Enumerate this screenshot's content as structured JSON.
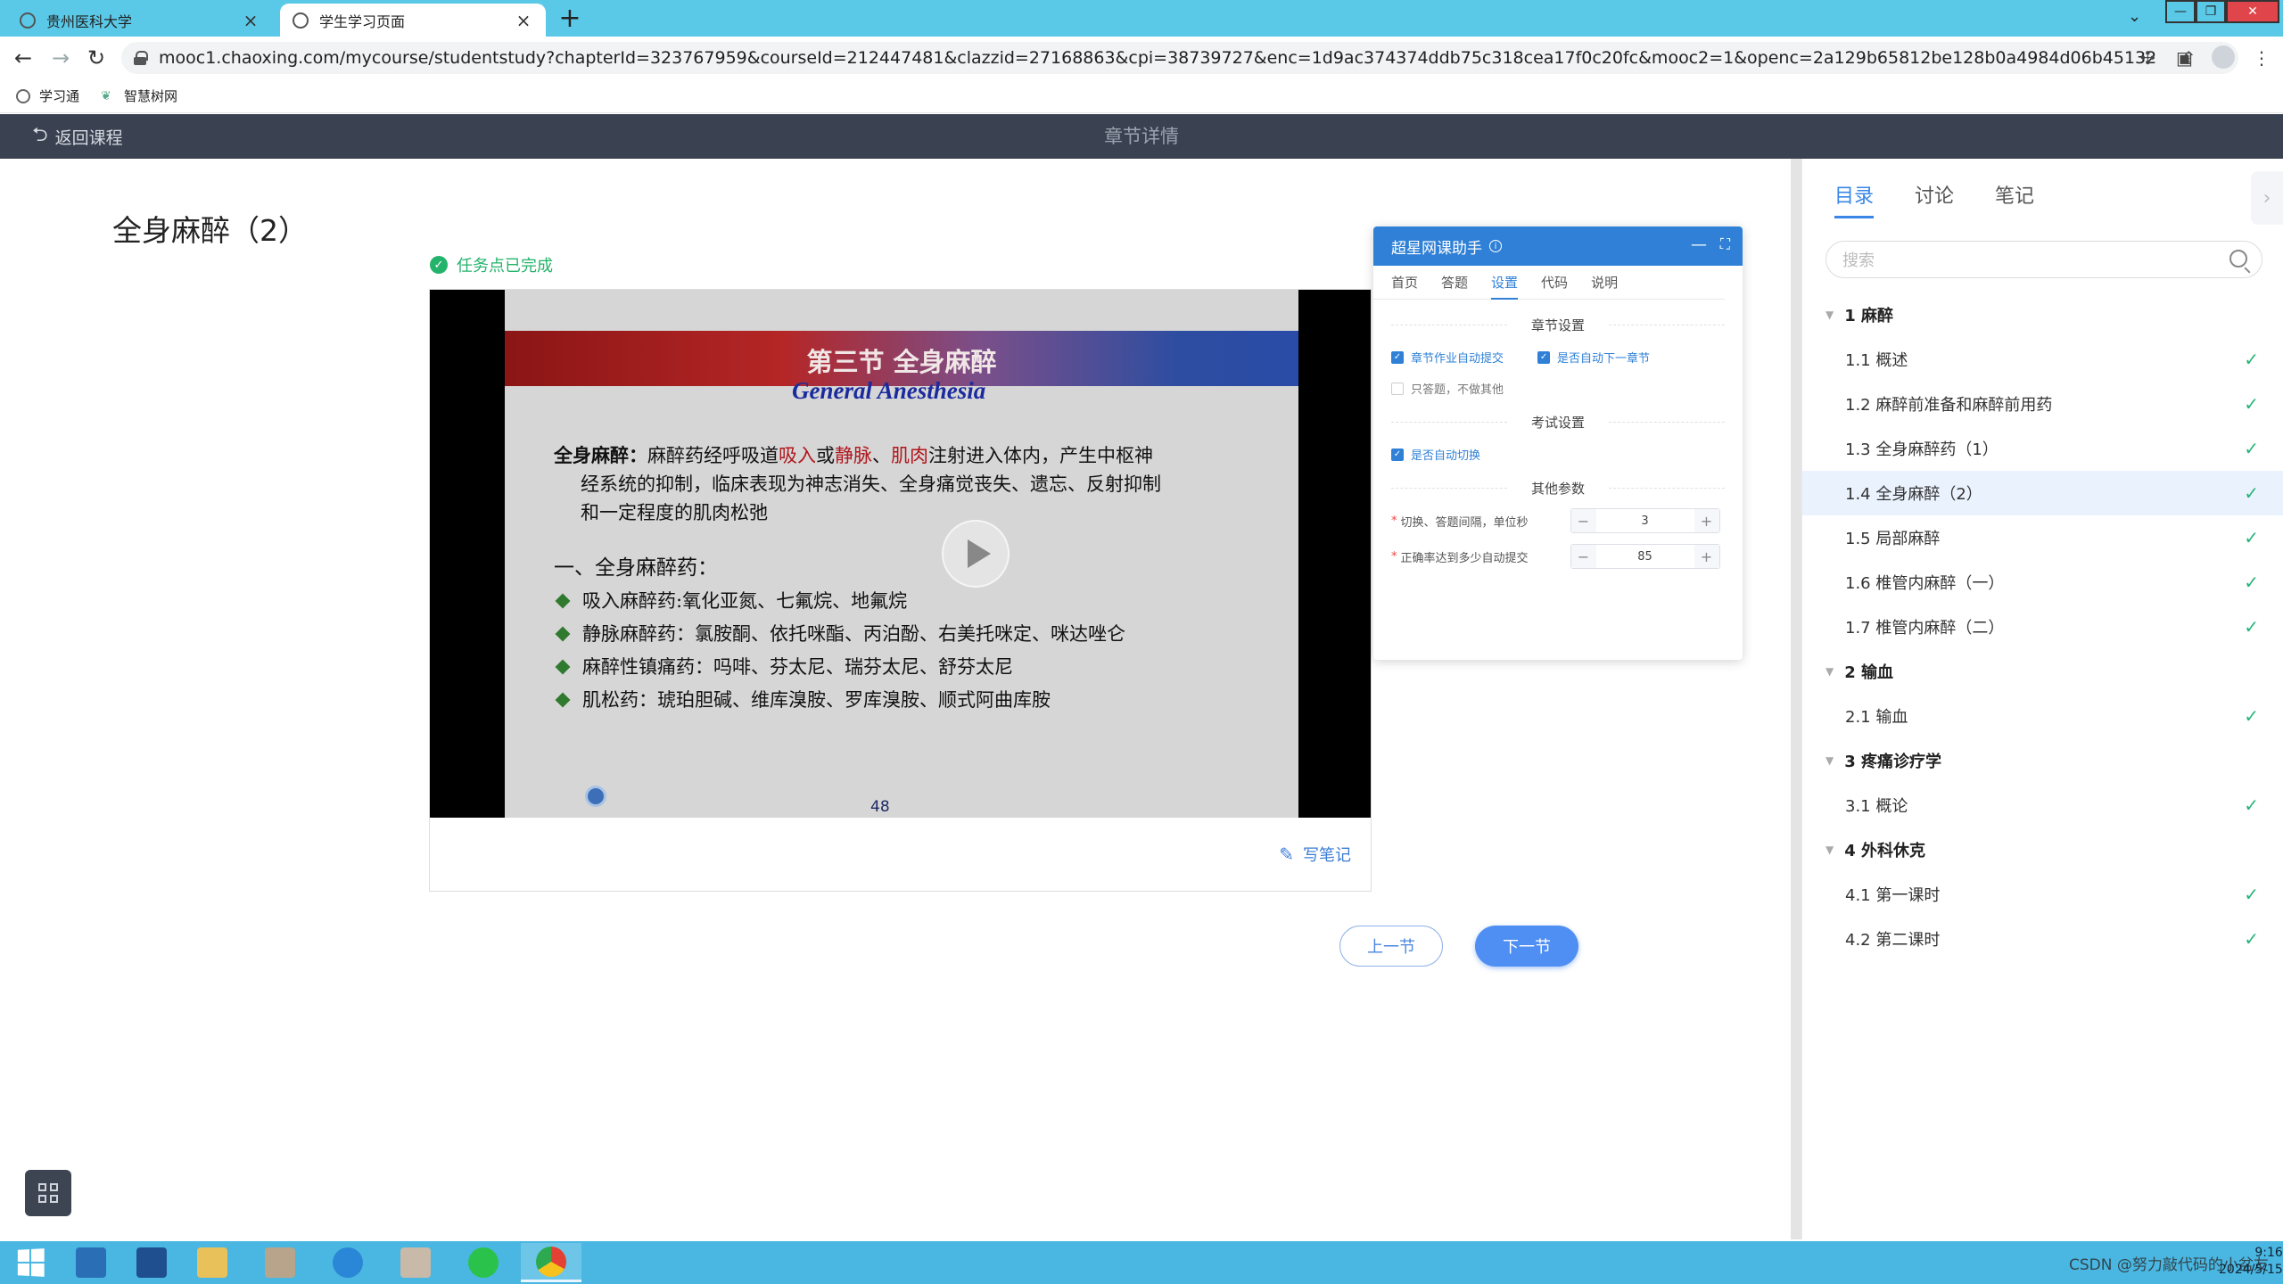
{
  "browser": {
    "tabs": [
      {
        "title": "贵州医科大学",
        "active": false
      },
      {
        "title": "学生学习页面",
        "active": true
      }
    ],
    "url": "mooc1.chaoxing.com/mycourse/studentstudy?chapterId=323767959&courseId=212447481&clazzid=27168863&cpi=38739727&enc=1d9ac374374ddb75c318cea17f0c20fc&mooc2=1&openc=2a129b65812be128b0a4984d06b45132",
    "bookmarks": [
      "学习通",
      "智慧树网"
    ]
  },
  "header": {
    "back_label": "返回课程",
    "title": "章节详情"
  },
  "main": {
    "chapter_title": "全身麻醉（2）",
    "task_status": "任务点已完成",
    "write_note": "写笔记",
    "prev_label": "上一节",
    "next_label": "下一节"
  },
  "slide": {
    "heading": "第三节  全身麻醉",
    "subheading": "General Anesthesia",
    "def_head": "全身麻醉：",
    "def_part1": "麻醉药经呼吸道",
    "def_inhale": "吸入",
    "def_or": "或",
    "def_iv": "静脉",
    "def_sep": "、",
    "def_im": "肌肉",
    "def_part2": "注射进入体内，产生中枢神",
    "def_line2": "经系统的抑制，临床表现为神志消失、全身痛觉丧失、遗忘、反射抑制",
    "def_line3": "和一定程度的肌肉松弛",
    "section": "一、全身麻醉药：",
    "bullets": [
      "吸入麻醉药:氧化亚氮、七氟烷、地氟烷",
      "静脉麻醉药：氯胺酮、依托咪酯、丙泊酚、右美托咪定、咪达唑仑",
      "麻醉性镇痛药：吗啡、芬太尼、瑞芬太尼、舒芬太尼",
      "肌松药：琥珀胆碱、维库溴胺、罗库溴胺、顺式阿曲库胺"
    ],
    "page_number": "48"
  },
  "helper": {
    "title": "超星网课助手",
    "tabs": [
      "首页",
      "答题",
      "设置",
      "代码",
      "说明"
    ],
    "active_tab": "设置",
    "chapter_settings": "章节设置",
    "opt_auto_submit": "章节作业自动提交",
    "opt_auto_next": "是否自动下一章节",
    "opt_answer_only": "只答题，不做其他",
    "exam_settings": "考试设置",
    "opt_auto_switch": "是否自动切换",
    "other_params": "其他参数",
    "param_interval_label": "切换、答题间隔，单位秒",
    "param_interval_value": "3",
    "param_accuracy_label": "正确率达到多少自动提交",
    "param_accuracy_value": "85"
  },
  "sidebar": {
    "tabs": [
      "目录",
      "讨论",
      "笔记"
    ],
    "search_placeholder": "搜索",
    "chapters": [
      {
        "title": "1 麻醉",
        "items": [
          "1.1 概述",
          "1.2 麻醉前准备和麻醉前用药",
          "1.3 全身麻醉药（1）",
          "1.4 全身麻醉（2）",
          "1.5 局部麻醉",
          "1.6 椎管内麻醉（一）",
          "1.7 椎管内麻醉（二）"
        ]
      },
      {
        "title": "2 输血",
        "items": [
          "2.1 输血"
        ]
      },
      {
        "title": "3 疼痛诊疗学",
        "items": [
          "3.1 概论"
        ]
      },
      {
        "title": "4 外科休克",
        "items": [
          "4.1 第一课时",
          "4.2 第二课时"
        ]
      }
    ],
    "current_item": "1.4 全身麻醉（2）"
  },
  "taskbar": {
    "tray_text": "CSDN @努力敲代码的小盆友",
    "time": "9:16",
    "date": "2024/5/15"
  },
  "colors": {
    "accent": "#2f80d6",
    "header_bg": "#3a4150",
    "complete_green": "#24b36b"
  }
}
